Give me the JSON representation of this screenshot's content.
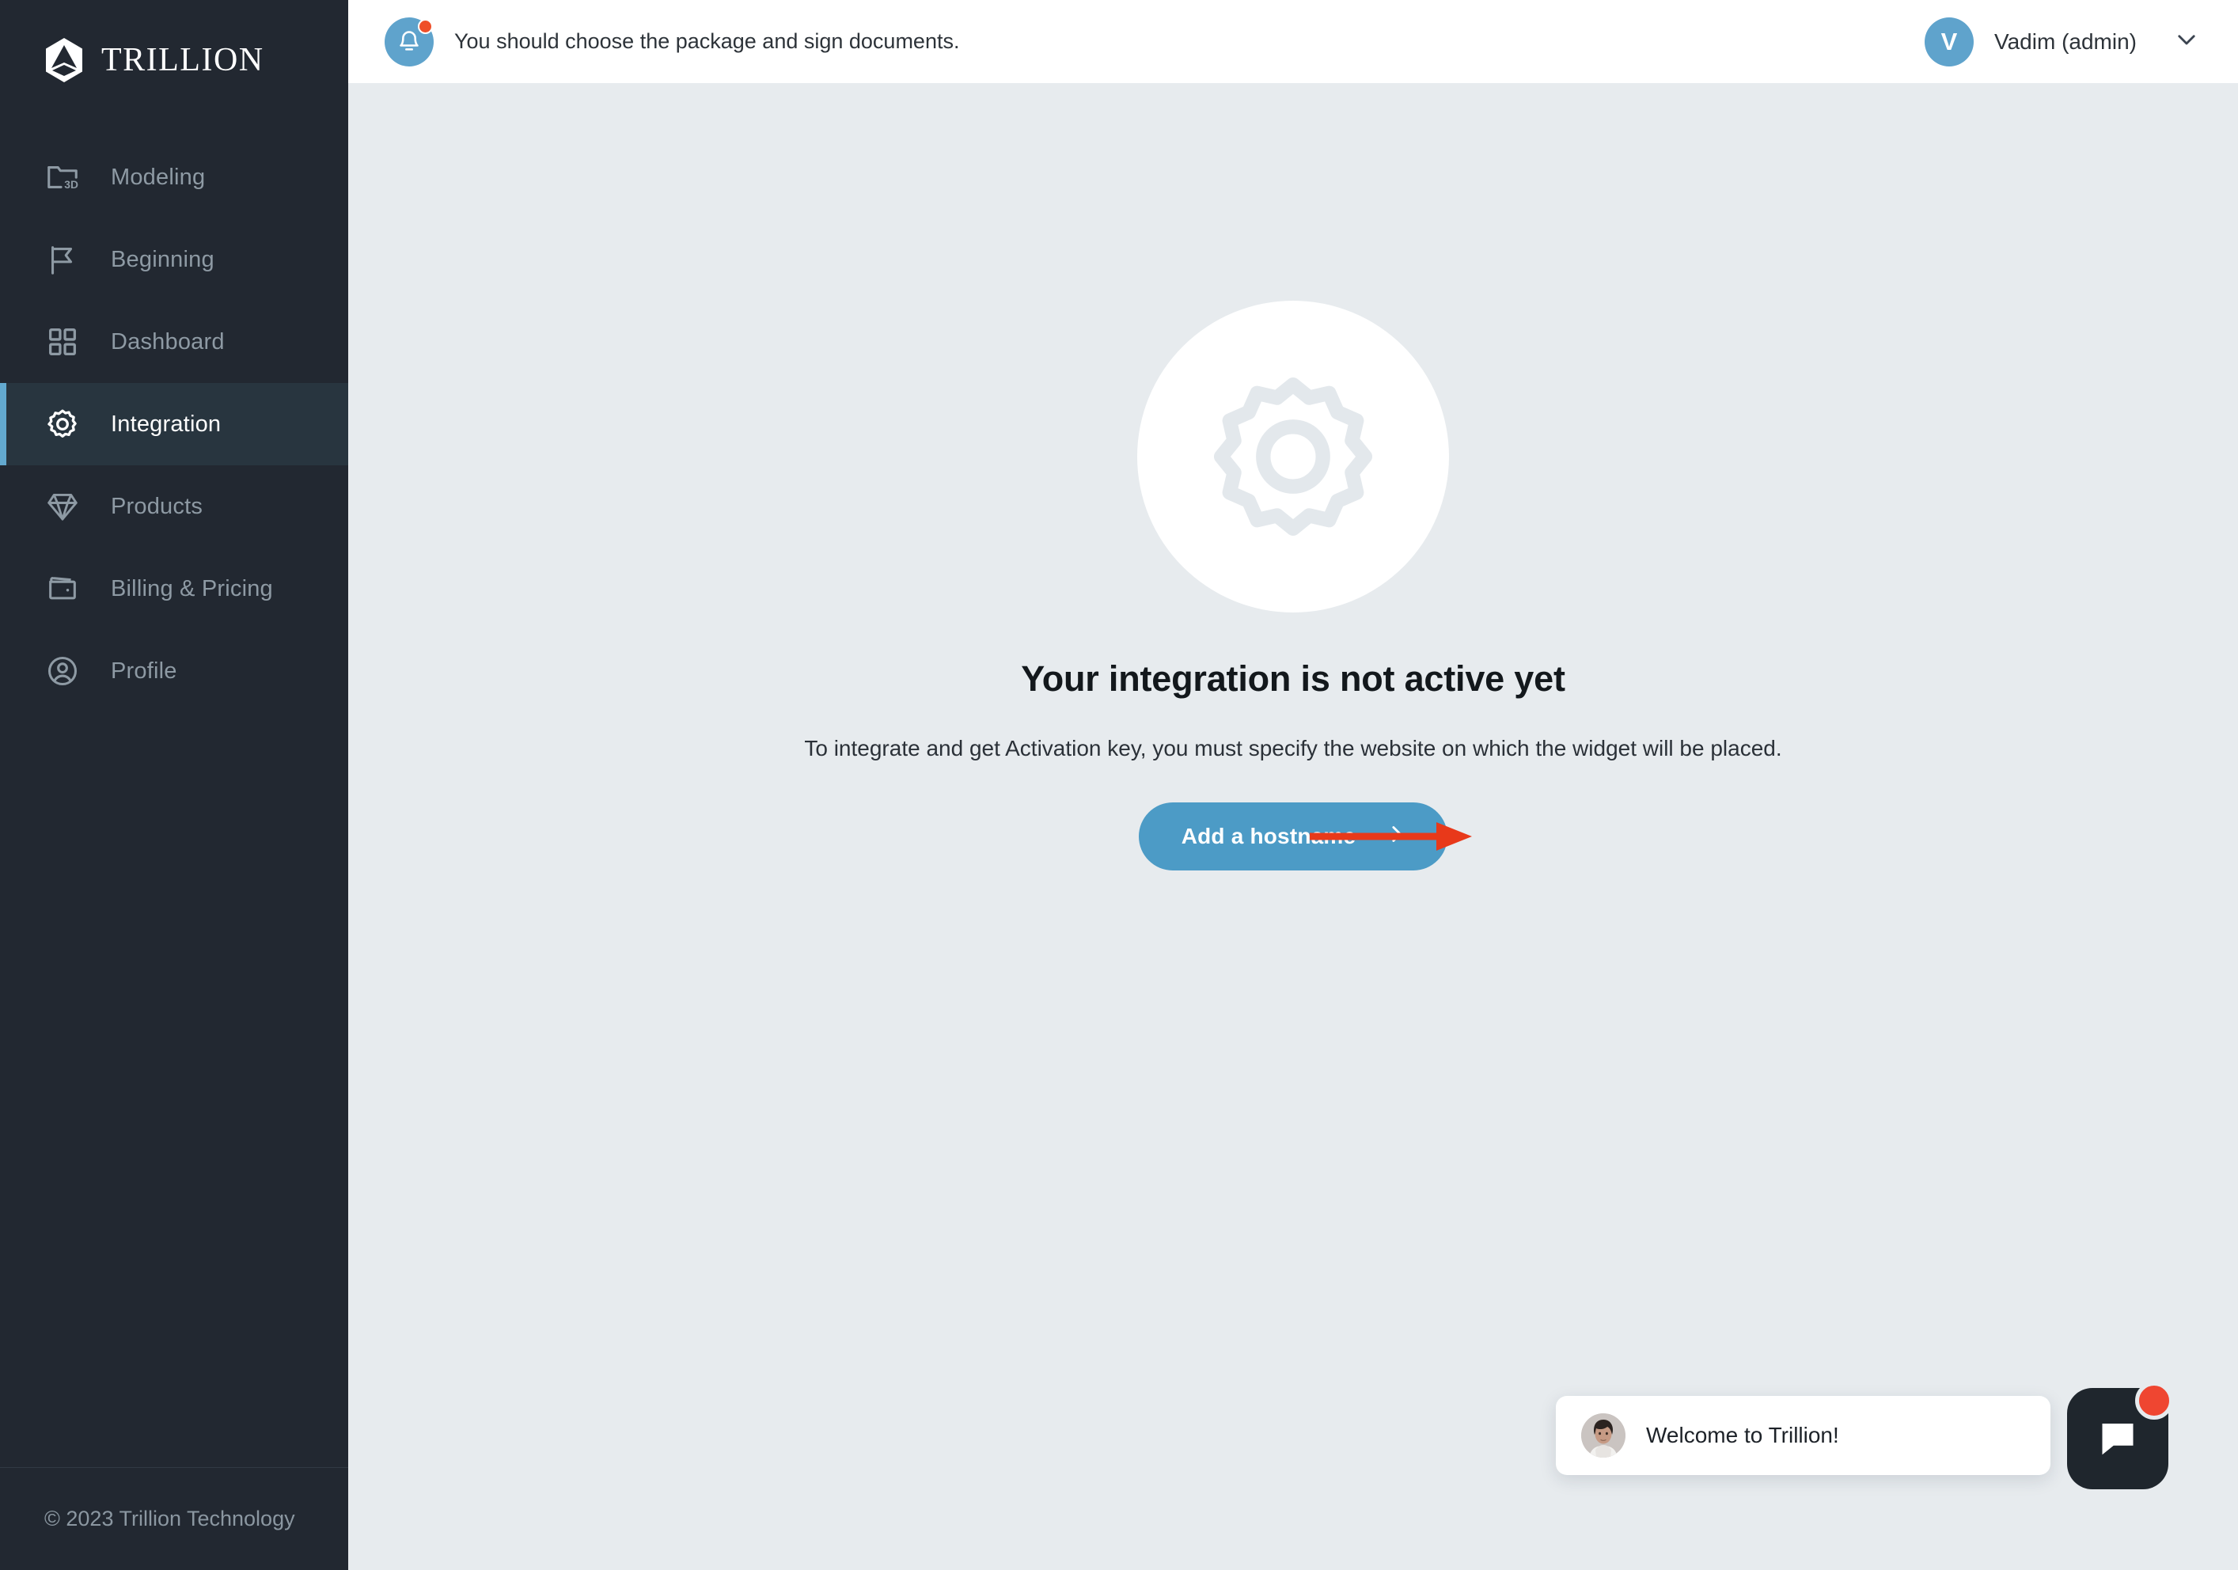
{
  "brand": {
    "name": "TRILLION",
    "logo_icon": "trillion-hexagon-logo"
  },
  "sidebar": {
    "items": [
      {
        "label": "Modeling",
        "icon": "folder-3d-icon",
        "active": false
      },
      {
        "label": "Beginning",
        "icon": "flag-icon",
        "active": false
      },
      {
        "label": "Dashboard",
        "icon": "grid-icon",
        "active": false
      },
      {
        "label": "Integration",
        "icon": "gear-icon",
        "active": true
      },
      {
        "label": "Products",
        "icon": "diamond-icon",
        "active": false
      },
      {
        "label": "Billing & Pricing",
        "icon": "wallet-icon",
        "active": false
      },
      {
        "label": "Profile",
        "icon": "user-circle-icon",
        "active": false
      }
    ],
    "footer": "© 2023 Trillion Technology",
    "accent_color": "#63a9cf",
    "background_color": "#222831"
  },
  "topbar": {
    "notification_icon": "bell-icon",
    "notification_message": "You should choose the package and sign documents.",
    "notification_dot_color": "#ef4f29",
    "user": {
      "avatar_initial": "V",
      "name": "Vadim (admin)",
      "avatar_color": "#5fa3cc",
      "chevron_icon": "chevron-down-icon"
    }
  },
  "main": {
    "hero_icon": "gear-icon",
    "headline": "Your integration is not active yet",
    "subtext": "To integrate and get Activation key, you must specify the website on which the widget will be placed.",
    "cta": {
      "label": "Add a hostname",
      "arrow_icon": "arrow-right-icon",
      "color": "#4c9bc6"
    },
    "annotation": {
      "type": "arrow-right",
      "color": "#e8391a"
    },
    "background_color": "#e7ebee"
  },
  "chat": {
    "message": "Welcome to Trillion!",
    "avatar_icon": "agent-photo-avatar",
    "launcher_icon": "chat-bubble-icon",
    "launcher_color": "#1f262d",
    "badge_color": "#ef4631"
  }
}
